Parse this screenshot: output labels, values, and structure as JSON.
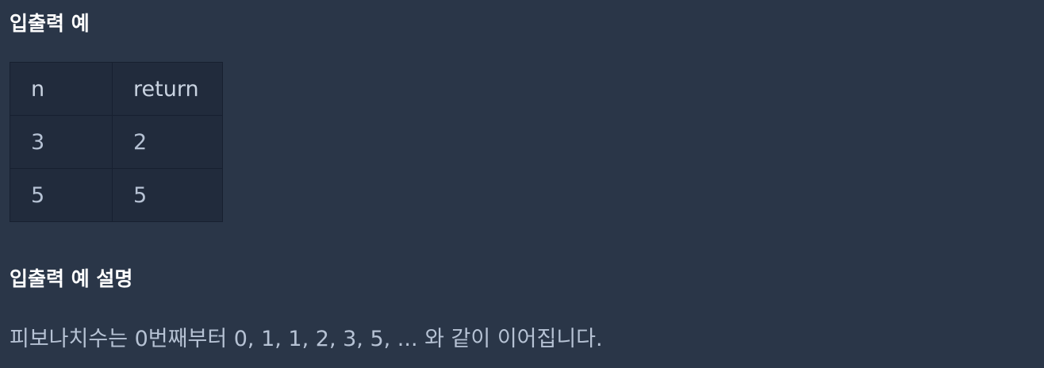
{
  "examples_section": {
    "title": "입출력 예",
    "table": {
      "headers": [
        "n",
        "return"
      ],
      "rows": [
        [
          "3",
          "2"
        ],
        [
          "5",
          "5"
        ]
      ]
    }
  },
  "explanation_section": {
    "title": "입출력 예 설명",
    "text": "피보나치수는 0번째부터 0, 1, 1, 2, 3, 5, ... 와 같이 이어집니다."
  },
  "colors": {
    "background": "#2a3648",
    "table_background": "#212b3c",
    "table_border": "#172030",
    "heading_text": "#ffffff",
    "body_text": "#b6c2d4"
  }
}
